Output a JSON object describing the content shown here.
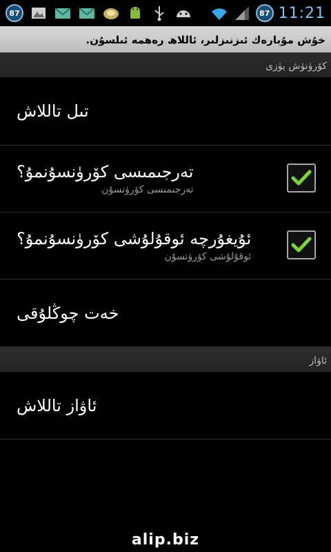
{
  "status_bar": {
    "battery_badge_left": "87",
    "battery_badge_right": "87",
    "time": "11:21",
    "icons": [
      "battery-badge-icon",
      "gallery-icon",
      "email-icon",
      "email-icon",
      "app-icon",
      "android-icon",
      "usb-icon",
      "android-head-icon",
      "wifi-icon",
      "signal-icon"
    ]
  },
  "header": {
    "title": "خۇش مۇبارەك ئىزنىزلىر، ئاللاھ رەھمە ئىلسۇن."
  },
  "sections": [
    {
      "header": "كۆرۈنۈش يۈزى",
      "items": [
        {
          "title": "تىل تاللاش",
          "summary": "",
          "checked": null
        },
        {
          "title": "تەرجىمىسى كۆرۈنسۇنمۇ؟",
          "summary": "تەرجىمىسى كۆرۈنسۇن",
          "checked": true
        },
        {
          "title": "ئۇيغۇرچە ئوقۇلۇشى كۆرۈنسۇنمۇ؟",
          "summary": "ئوقۇلۇشى كۆرۈنسۇن",
          "checked": true
        },
        {
          "title": "خەت چوڭلۇقى",
          "summary": "",
          "checked": null
        }
      ]
    },
    {
      "header": "ئاۋاز",
      "items": [
        {
          "title": "ئاۋاز تاللاش",
          "summary": "",
          "checked": null
        }
      ]
    }
  ],
  "watermark": "alip.biz",
  "colors": {
    "background": "#000000",
    "titlebar": "#c8c8c8",
    "section_header": "#282828",
    "checkmark": "#7dd33a",
    "clock": "#7fc4f0"
  }
}
